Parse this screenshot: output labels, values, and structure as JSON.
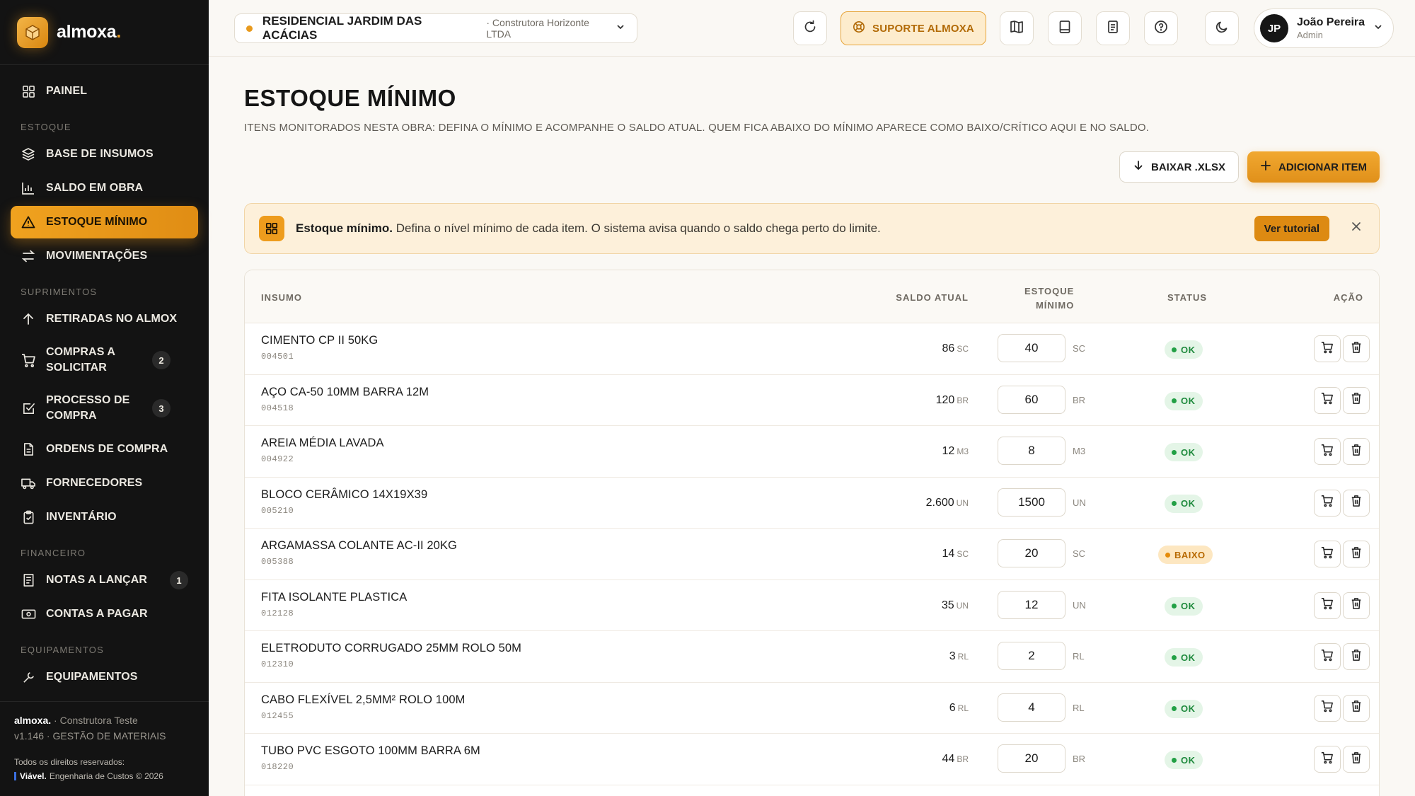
{
  "app": {
    "brand": "almoxa",
    "brand_dot": "."
  },
  "sidebar": {
    "items": [
      {
        "label": "PAINEL",
        "icon": "grid-icon"
      },
      {
        "section": "ESTOQUE"
      },
      {
        "label": "BASE DE INSUMOS",
        "icon": "layers-icon"
      },
      {
        "label": "SALDO EM OBRA",
        "icon": "bar-chart-icon"
      },
      {
        "label": "ESTOQUE MÍNIMO",
        "icon": "warning-icon",
        "active": true
      },
      {
        "label": "MOVIMENTAÇÕES",
        "icon": "swap-icon"
      },
      {
        "section": "SUPRIMENTOS"
      },
      {
        "label": "RETIRADAS NO ALMOX",
        "icon": "arrow-up-icon"
      },
      {
        "label": "COMPRAS A SOLICITAR",
        "icon": "cart-icon",
        "badge": "2"
      },
      {
        "label": "PROCESSO DE COMPRA",
        "icon": "check-square-icon",
        "badge": "3"
      },
      {
        "label": "ORDENS DE COMPRA",
        "icon": "file-icon"
      },
      {
        "label": "FORNECEDORES",
        "icon": "truck-icon"
      },
      {
        "label": "INVENTÁRIO",
        "icon": "clipboard-check-icon"
      },
      {
        "section": "FINANCEIRO"
      },
      {
        "label": "NOTAS A LANÇAR",
        "icon": "receipt-icon",
        "badge": "1"
      },
      {
        "label": "CONTAS A PAGAR",
        "icon": "banknote-icon"
      },
      {
        "section": "EQUIPAMENTOS"
      },
      {
        "label": "EQUIPAMENTOS",
        "icon": "tool-icon"
      }
    ],
    "footer": {
      "brand": "almoxa.",
      "company": "· Construtora Teste",
      "version": "v1.146 · GESTÃO DE MATERIAIS",
      "rights": "Todos os direitos reservados:",
      "vendor": "Viável.",
      "vendor_rest": "Engenharia de Custos © 2026"
    }
  },
  "topbar": {
    "project_name": "RESIDENCIAL JARDIM DAS ACÁCIAS",
    "project_company": "· Construtora Horizonte LTDA",
    "support_label": "SUPORTE ALMOXA",
    "user_name": "João Pereira",
    "user_role": "Admin",
    "user_initials": "JP"
  },
  "page": {
    "title": "ESTOQUE MÍNIMO",
    "description": "ITENS MONITORADOS NESTA OBRA: DEFINA O MÍNIMO E ACOMPANHE O SALDO ATUAL. QUEM FICA ABAIXO DO MÍNIMO APARECE COMO BAIXO/CRÍTICO AQUI E NO SALDO.",
    "download_label": "BAIXAR .XLSX",
    "add_label": "ADICIONAR ITEM"
  },
  "banner": {
    "title": "Estoque mínimo.",
    "text": " Defina o nível mínimo de cada item. O sistema avisa quando o saldo chega perto do limite.",
    "button": "Ver tutorial"
  },
  "table": {
    "headers": {
      "insumo": "INSUMO",
      "saldo": "SALDO ATUAL",
      "minimo_1": "ESTOQUE",
      "minimo_2": "MÍNIMO",
      "status": "STATUS",
      "acao": "AÇÃO"
    },
    "rows": [
      {
        "name": "CIMENTO CP II 50KG",
        "code": "004501",
        "saldo": "86",
        "unit": "SC",
        "min": "40",
        "status": "OK"
      },
      {
        "name": "AÇO CA-50 10MM BARRA 12M",
        "code": "004518",
        "saldo": "120",
        "unit": "BR",
        "min": "60",
        "status": "OK"
      },
      {
        "name": "AREIA MÉDIA LAVADA",
        "code": "004922",
        "saldo": "12",
        "unit": "M3",
        "min": "8",
        "status": "OK"
      },
      {
        "name": "BLOCO CERÂMICO 14X19X39",
        "code": "005210",
        "saldo": "2.600",
        "unit": "UN",
        "min": "1500",
        "status": "OK"
      },
      {
        "name": "ARGAMASSA COLANTE AC-II 20KG",
        "code": "005388",
        "saldo": "14",
        "unit": "SC",
        "min": "20",
        "status": "BAIXO"
      },
      {
        "name": "FITA ISOLANTE PLASTICA",
        "code": "012128",
        "saldo": "35",
        "unit": "UN",
        "min": "12",
        "status": "OK"
      },
      {
        "name": "ELETRODUTO CORRUGADO 25MM ROLO 50M",
        "code": "012310",
        "saldo": "3",
        "unit": "RL",
        "min": "2",
        "status": "OK"
      },
      {
        "name": "CABO FLEXÍVEL 2,5MM² ROLO 100M",
        "code": "012455",
        "saldo": "6",
        "unit": "RL",
        "min": "4",
        "status": "OK"
      },
      {
        "name": "TUBO PVC ESGOTO 100MM BARRA 6M",
        "code": "018220",
        "saldo": "44",
        "unit": "BR",
        "min": "20",
        "status": "OK"
      }
    ]
  }
}
